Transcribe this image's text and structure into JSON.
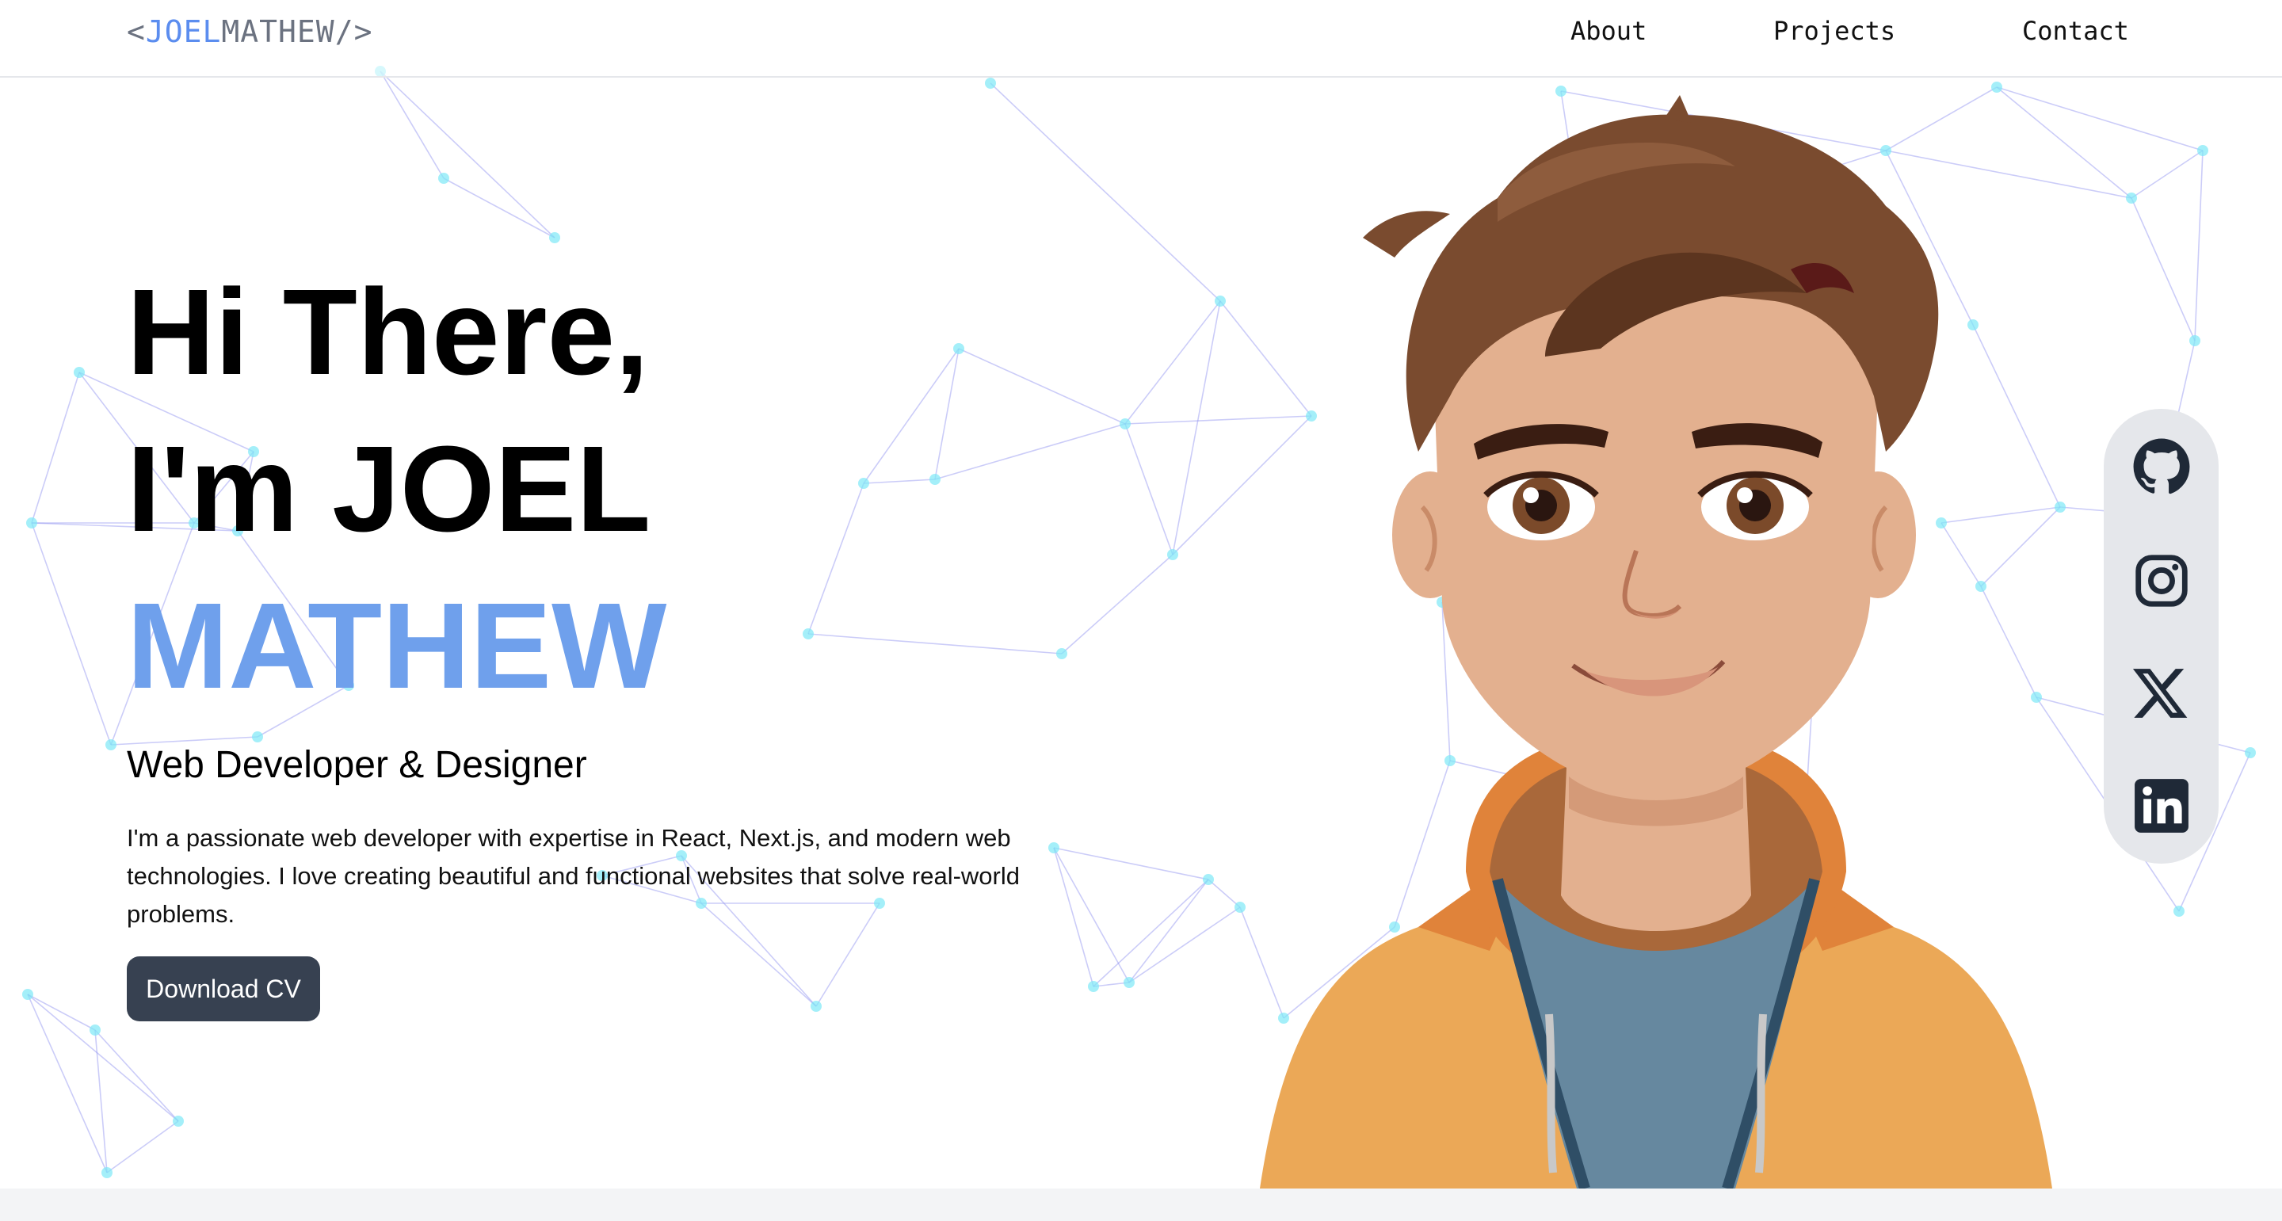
{
  "nav": {
    "logo": {
      "open": "<",
      "first": "JOEL",
      "last": "MATHEW",
      "close": "/>"
    },
    "links": [
      "About",
      "Projects",
      "Contact"
    ]
  },
  "hero": {
    "greeting": "Hi There,",
    "name_line": "I'm JOEL",
    "surname": "MATHEW",
    "subtitle": "Web Developer & Designer",
    "bio": "I'm a passionate web developer with expertise in React, Next.js, and modern web technologies. I love creating beautiful and functional websites that solve real-world problems.",
    "cta": "Download CV"
  },
  "social": {
    "icons": [
      "github-icon",
      "instagram-icon",
      "x-icon",
      "linkedin-icon"
    ]
  },
  "colors": {
    "accent": "#6fa0ec",
    "logo_accent": "#5b8def",
    "button_bg": "#374151",
    "social_bar_bg": "#e5e7eb",
    "network_line": "#8b8ef0",
    "network_node": "#7ee8f6"
  }
}
